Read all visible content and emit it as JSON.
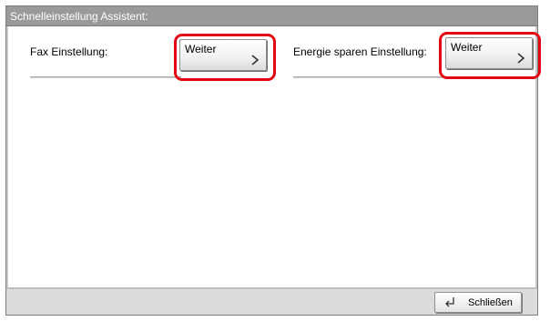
{
  "window": {
    "title": "Schnelleinstellung Assistent:"
  },
  "settings": [
    {
      "label": "Fax Einstellung:",
      "button_label": "Weiter"
    },
    {
      "label": "Energie sparen Einstellung:",
      "button_label": "Weiter"
    }
  ],
  "footer": {
    "close_label": "Schließen"
  },
  "colors": {
    "highlight": "#e30613",
    "titlebar": "#9a9a9a",
    "footer": "#dcdcdc"
  },
  "icons": {
    "next": "chevron-right-icon",
    "close": "return-arrow-icon"
  }
}
